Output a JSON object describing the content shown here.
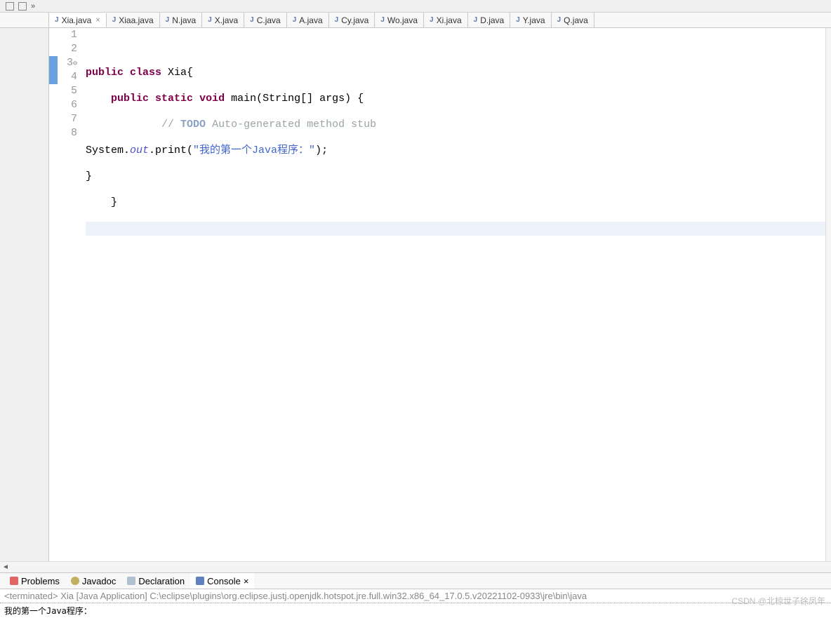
{
  "toolbar": {
    "chevron": "»"
  },
  "tabs": [
    {
      "label": "Xia.java",
      "active": true,
      "close": true
    },
    {
      "label": "Xiaa.java"
    },
    {
      "label": "N.java"
    },
    {
      "label": "X.java"
    },
    {
      "label": "C.java"
    },
    {
      "label": "A.java"
    },
    {
      "label": "Cy.java"
    },
    {
      "label": "Wo.java"
    },
    {
      "label": "Xi.java"
    },
    {
      "label": "D.java"
    },
    {
      "label": "Y.java"
    },
    {
      "label": "Q.java"
    }
  ],
  "gutter": {
    "numbers": [
      "1",
      "2",
      "3",
      "4",
      "5",
      "6",
      "7",
      "8"
    ],
    "fold3": "⊖",
    "markers": [
      3,
      4
    ]
  },
  "code": {
    "l1": "",
    "l2": {
      "kw1": "public",
      "kw2": "class",
      "name": " Xia{"
    },
    "l3": {
      "indent": "    ",
      "kw1": "public",
      "kw2": "static",
      "kw3": "void",
      "rest": " main(String[] args) {"
    },
    "l4": {
      "indent": "            ",
      "slash": "// ",
      "todo": "TODO",
      "rest": " Auto-generated method stub"
    },
    "l5": {
      "pre": "System.",
      "out": "out",
      "mid": ".print(",
      "str": "\"我的第一个Java程序：\"",
      "post": ");"
    },
    "l6": "}",
    "l7": "    }",
    "l8": ""
  },
  "views": {
    "problems": "Problems",
    "javadoc": "Javadoc",
    "declaration": "Declaration",
    "console": "Console",
    "close": "×"
  },
  "console": {
    "header": "<terminated> Xia [Java Application] C:\\eclipse\\plugins\\org.eclipse.justj.openjdk.hotspot.jre.full.win32.x86_64_17.0.5.v20221102-0933\\jre\\bin\\java",
    "output": "我的第一个Java程序："
  },
  "watermark": "CSDN @北椋世子徐凤年"
}
